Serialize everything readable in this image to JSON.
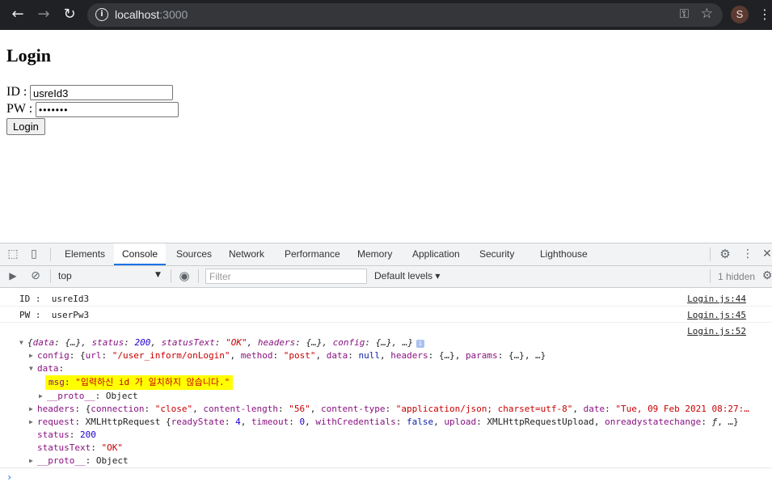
{
  "browser": {
    "url_host": "localhost",
    "url_port": ":3000",
    "profile_initial": "S"
  },
  "page": {
    "title": "Login",
    "id_label": "ID :",
    "id_value": "usreId3",
    "pw_label": "PW :",
    "pw_value": "•••••••",
    "login_button": "Login"
  },
  "devtools": {
    "tabs": [
      "Elements",
      "Console",
      "Sources",
      "Network",
      "Performance",
      "Memory",
      "Application",
      "Security",
      "Lighthouse"
    ],
    "active_tab": "Console",
    "context": "top",
    "filter_placeholder": "Filter",
    "levels": "Default levels",
    "hidden": "1 hidden",
    "messages": [
      {
        "text": "ID :  usreId3",
        "source": "Login.js:44"
      },
      {
        "text": "PW :  userPw3",
        "source": "Login.js:45"
      },
      {
        "text": "",
        "source": "Login.js:52"
      }
    ],
    "object": {
      "summary": {
        "data": "{…}",
        "status": "200",
        "statusText": "\"OK\"",
        "headers": "{…}",
        "config": "{…}"
      },
      "config": {
        "url": "\"/user_inform/onLogin\"",
        "method": "\"post\"",
        "data": "null",
        "headers": "{…}",
        "params": "{…}"
      },
      "msg": "\"입력하신 id 가 일치하지 않습니다.\"",
      "data_proto": "Object",
      "headers": {
        "connection": "\"close\"",
        "content_length": "\"56\"",
        "content_type": "\"application/json; charset=utf-8\"",
        "date": "\"Tue, 09 Feb 2021 08:27:…"
      },
      "request": {
        "type": "XMLHttpRequest",
        "readyState": "4",
        "timeout": "0",
        "withCredentials": "false",
        "upload": "XMLHttpRequestUpload",
        "onreadystatechange": "ƒ"
      },
      "status": "200",
      "statusText": "\"OK\"",
      "proto": "Object"
    }
  }
}
